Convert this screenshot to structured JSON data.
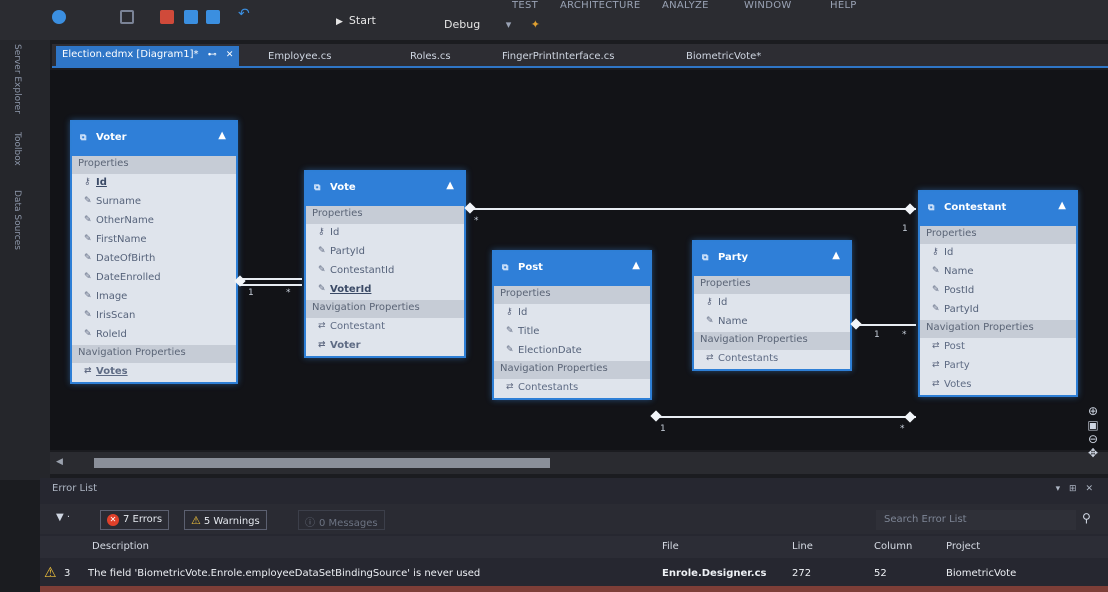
{
  "menu": {
    "items": [
      "TEST",
      "ARCHITECTURE",
      "ANALYZE",
      "WINDOW",
      "HELP"
    ]
  },
  "toolbar": {
    "start_label": "Start",
    "config_label": "Debug"
  },
  "tabs": [
    {
      "label": "Election.edmx [Diagram1]*",
      "active": true
    },
    {
      "label": "Employee.cs"
    },
    {
      "label": "Roles.cs"
    },
    {
      "label": "FingerPrintInterface.cs"
    },
    {
      "label": "BiometricVote*"
    }
  ],
  "sidebar": {
    "items": [
      "Server Explorer",
      "Toolbox",
      "Data Sources"
    ]
  },
  "diagram": {
    "entities": {
      "voter": {
        "title": "Voter",
        "properties_label": "Properties",
        "properties": [
          "Id",
          "Surname",
          "OtherName",
          "FirstName",
          "DateOfBirth",
          "DateEnrolled",
          "Image",
          "IrisScan",
          "RoleId"
        ],
        "nav_label": "Navigation Properties",
        "nav": [
          "Votes"
        ]
      },
      "vote": {
        "title": "Vote",
        "properties_label": "Properties",
        "properties": [
          "Id",
          "PartyId",
          "ContestantId",
          "VoterId"
        ],
        "nav_label": "Navigation Properties",
        "nav": [
          "Contestant",
          "Voter"
        ]
      },
      "post": {
        "title": "Post",
        "properties_label": "Properties",
        "properties": [
          "Id",
          "Title",
          "ElectionDate"
        ],
        "nav_label": "Navigation Properties",
        "nav": [
          "Contestants"
        ]
      },
      "party": {
        "title": "Party",
        "properties_label": "Properties",
        "properties": [
          "Id",
          "Name"
        ],
        "nav_label": "Navigation Properties",
        "nav": [
          "Contestants"
        ]
      },
      "contestant": {
        "title": "Contestant",
        "properties_label": "Properties",
        "properties": [
          "Id",
          "Name",
          "PostId",
          "PartyId"
        ],
        "nav_label": "Navigation Properties",
        "nav": [
          "Post",
          "Party",
          "Votes"
        ]
      }
    },
    "multiplicity": {
      "one": "1",
      "many": "*"
    }
  },
  "error_list": {
    "title": "Error List",
    "errors_chip": "7 Errors",
    "warnings_chip": "5 Warnings",
    "messages_chip": "0 Messages",
    "search_placeholder": "Search Error List",
    "columns": {
      "description": "Description",
      "file": "File",
      "line": "Line",
      "column": "Column",
      "project": "Project"
    },
    "rows": [
      {
        "num": "3",
        "description": "The field 'BiometricVote.Enrole.employeeDataSetBindingSource' is never used",
        "file": "Enrole.Designer.cs",
        "line": "272",
        "column": "52",
        "project": "BiometricVote"
      }
    ]
  },
  "colors": {
    "accent": "#2f7fd8",
    "canvas": "#121317",
    "error": "#e0402a",
    "warning": "#f2c33b"
  }
}
